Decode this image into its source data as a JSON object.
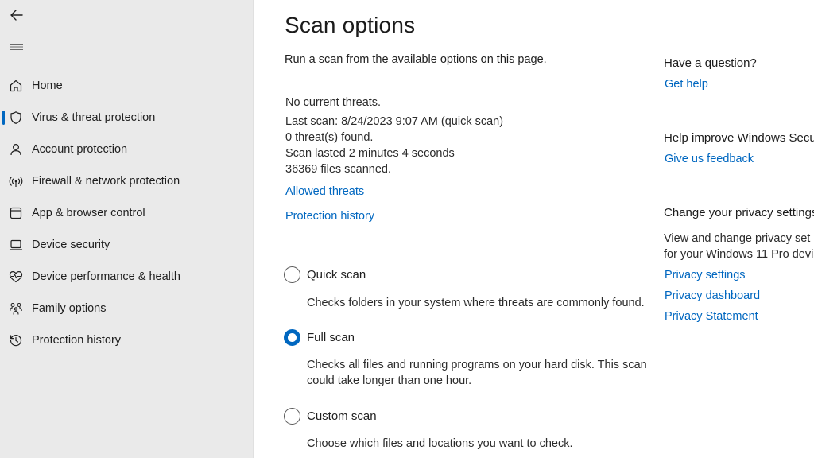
{
  "sidebar": {
    "back_icon": "arrow-left-icon",
    "menu_icon": "hamburger-menu-icon",
    "items": [
      {
        "label": "Home",
        "icon": "home-icon",
        "active": false
      },
      {
        "label": "Virus & threat protection",
        "icon": "shield-icon",
        "active": true
      },
      {
        "label": "Account protection",
        "icon": "person-icon",
        "active": false
      },
      {
        "label": "Firewall & network protection",
        "icon": "wifi-signal-icon",
        "active": false
      },
      {
        "label": "App & browser control",
        "icon": "browser-window-icon",
        "active": false
      },
      {
        "label": "Device security",
        "icon": "laptop-icon",
        "active": false
      },
      {
        "label": "Device performance & health",
        "icon": "heart-pulse-icon",
        "active": false
      },
      {
        "label": "Family options",
        "icon": "family-icon",
        "active": false
      },
      {
        "label": "Protection history",
        "icon": "history-icon",
        "active": false
      }
    ]
  },
  "main": {
    "title": "Scan options",
    "subtitle": "Run a scan from the available options on this page.",
    "status": {
      "threats": "No current threats.",
      "last_scan": "Last scan: 8/24/2023 9:07 AM (quick scan)",
      "found": "0 threat(s) found.",
      "duration": "Scan lasted 2 minutes 4 seconds",
      "files": "36369 files scanned."
    },
    "links": {
      "allowed_threats": "Allowed threats",
      "protection_history": "Protection history"
    },
    "scan_options": [
      {
        "label": "Quick scan",
        "description": "Checks folders in your system where threats are commonly found.",
        "selected": false
      },
      {
        "label": "Full scan",
        "description_line1": "Checks all files and running programs on your hard disk. This scan",
        "description_line2": "could take longer than one hour.",
        "selected": true
      },
      {
        "label": "Custom scan",
        "description": "Choose which files and locations you want to check.",
        "selected": false
      }
    ]
  },
  "aside": {
    "question_heading": "Have a question?",
    "get_help": "Get help",
    "improve_heading": "Help improve Windows Secu",
    "feedback": "Give us feedback",
    "privacy_heading": "Change your privacy settings",
    "privacy_text_line1": "View and change privacy set",
    "privacy_text_line2": "for your Windows 11 Pro devi",
    "privacy_settings": "Privacy settings",
    "privacy_dashboard": "Privacy dashboard",
    "privacy_statement": "Privacy Statement"
  },
  "colors": {
    "accent": "#0067c0",
    "sidebar_bg": "#eaeaea",
    "main_bg": "#ffffff"
  }
}
